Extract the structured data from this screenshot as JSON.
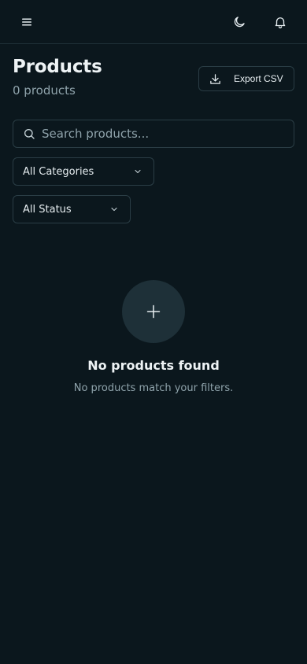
{
  "header": {
    "menu_icon": "hamburger-icon",
    "theme_icon": "moon-icon",
    "notification_icon": "bell-icon"
  },
  "page": {
    "title": "Products",
    "count_label": "0 products"
  },
  "actions": {
    "export_label": "Export CSV",
    "export_icon": "download-icon"
  },
  "filters": {
    "search_placeholder": "Search products...",
    "category_selected": "All Categories",
    "status_selected": "All Status"
  },
  "empty_state": {
    "icon": "plus-icon",
    "title": "No products found",
    "subtitle": "No products match your filters."
  },
  "colors": {
    "background": "#0b171d",
    "border": "#2a3d45",
    "muted_text": "#8fa3ab",
    "circle": "#1e3038"
  }
}
